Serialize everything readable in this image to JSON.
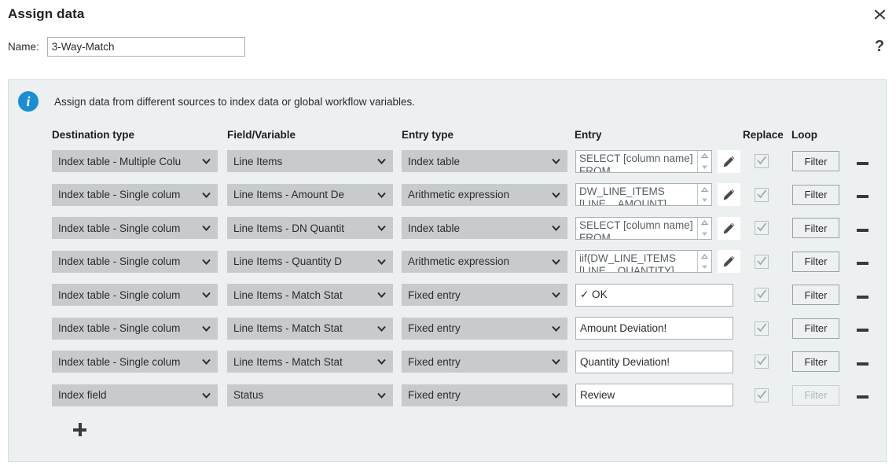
{
  "dialog": {
    "title": "Assign data",
    "close_icon": "close-icon",
    "help_icon": "help-icon",
    "help_label": "?"
  },
  "name_field": {
    "label": "Name:",
    "value": "3-Way-Match",
    "placeholder": ""
  },
  "info": {
    "icon": "info-icon",
    "text": "Assign data from different sources to index data or global workflow variables."
  },
  "columns": {
    "destination_type": "Destination type",
    "field_variable": "Field/Variable",
    "entry_type": "Entry type",
    "entry": "Entry",
    "replace": "Replace",
    "loop": "Loop"
  },
  "labels": {
    "filter": "Filter",
    "add_row": "Add row",
    "remove_row": "Remove row",
    "edit": "Edit entry",
    "spinner_up": "Increase",
    "spinner_down": "Decrease"
  },
  "rows": [
    {
      "destination_type": "Index table - Multiple Colu",
      "field_variable": "Line Items",
      "entry_type": "Index table",
      "entry": "SELECT [column name] FROM",
      "entry_multiline": true,
      "entry_has_spinner": true,
      "entry_has_pencil": true,
      "entry_placeholder_style": true,
      "replace_checked": true,
      "replace_enabled": false,
      "filter_enabled": true
    },
    {
      "destination_type": "Index table - Single colum",
      "field_variable": "Line Items - Amount De",
      "entry_type": "Arithmetic expression",
      "entry": "DW_LINE_ITEMS [LINE__AMOUNT]",
      "entry_multiline": true,
      "entry_has_spinner": true,
      "entry_has_pencil": true,
      "entry_placeholder_style": true,
      "replace_checked": true,
      "replace_enabled": false,
      "filter_enabled": true
    },
    {
      "destination_type": "Index table - Single colum",
      "field_variable": "Line Items - DN Quantit",
      "entry_type": "Index table",
      "entry": "SELECT [column name] FROM",
      "entry_multiline": true,
      "entry_has_spinner": true,
      "entry_has_pencil": true,
      "entry_placeholder_style": true,
      "replace_checked": true,
      "replace_enabled": false,
      "filter_enabled": true
    },
    {
      "destination_type": "Index table - Single colum",
      "field_variable": "Line Items - Quantity D",
      "entry_type": "Arithmetic expression",
      "entry": "iif(DW_LINE_ITEMS [LINE__QUANTITY]",
      "entry_multiline": true,
      "entry_has_spinner": true,
      "entry_has_pencil": true,
      "entry_placeholder_style": true,
      "replace_checked": true,
      "replace_enabled": false,
      "filter_enabled": true
    },
    {
      "destination_type": "Index table - Single colum",
      "field_variable": "Line Items - Match Stat",
      "entry_type": "Fixed entry",
      "entry": "✓ OK",
      "entry_multiline": false,
      "entry_has_spinner": false,
      "entry_has_pencil": false,
      "entry_placeholder_style": false,
      "replace_checked": true,
      "replace_enabled": false,
      "filter_enabled": true
    },
    {
      "destination_type": "Index table - Single colum",
      "field_variable": "Line Items - Match Stat",
      "entry_type": "Fixed entry",
      "entry": "Amount Deviation!",
      "entry_multiline": false,
      "entry_has_spinner": false,
      "entry_has_pencil": false,
      "entry_placeholder_style": false,
      "replace_checked": true,
      "replace_enabled": false,
      "filter_enabled": true
    },
    {
      "destination_type": "Index table - Single colum",
      "field_variable": "Line Items - Match Stat",
      "entry_type": "Fixed entry",
      "entry": "Quantity Deviation!",
      "entry_multiline": false,
      "entry_has_spinner": false,
      "entry_has_pencil": false,
      "entry_placeholder_style": false,
      "replace_checked": true,
      "replace_enabled": false,
      "filter_enabled": true
    },
    {
      "destination_type": "Index field",
      "field_variable": "Status",
      "entry_type": "Fixed entry",
      "entry": "Review",
      "entry_multiline": false,
      "entry_has_spinner": false,
      "entry_has_pencil": false,
      "entry_placeholder_style": false,
      "replace_checked": true,
      "replace_enabled": false,
      "filter_enabled": false
    }
  ],
  "colors": {
    "panel_bg": "#edf0f1",
    "select_bg": "#c7cbce",
    "info_blue": "#1b8ed2",
    "text": "#2b2b2b"
  }
}
